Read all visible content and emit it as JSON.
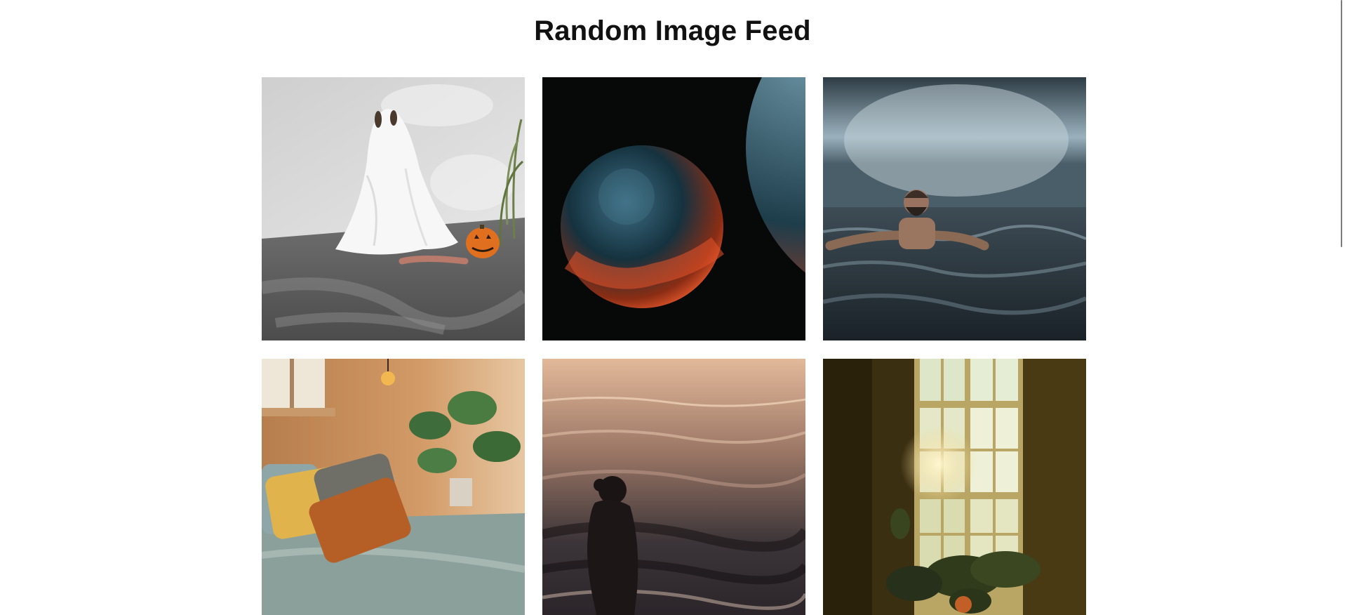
{
  "page": {
    "title": "Random Image Feed"
  },
  "images": [
    {
      "subject": "ghost-costume-with-pumpkin"
    },
    {
      "subject": "planets-in-space"
    },
    {
      "subject": "man-in-waterfall-pool"
    },
    {
      "subject": "bedroom-with-plants"
    },
    {
      "subject": "woman-silhouette-by-sea"
    },
    {
      "subject": "sunlit-window-with-plants"
    }
  ],
  "colors": {
    "background": "#ffffff",
    "title": "#111111",
    "scrollbar_thumb": "#7a7a7a"
  }
}
